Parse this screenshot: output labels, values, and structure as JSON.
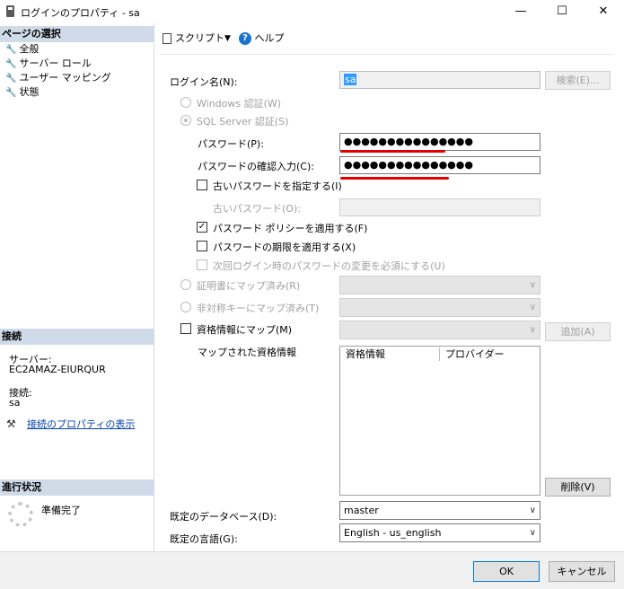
{
  "window": {
    "title": "ログインのプロパティ - sa",
    "minimize": "—",
    "maximize": "☐",
    "close": "✕"
  },
  "left_panel": {
    "page_select_header": "ページの選択",
    "pages": [
      {
        "label": "全般"
      },
      {
        "label": "サーバー ロール"
      },
      {
        "label": "ユーザー マッピング"
      },
      {
        "label": "状態"
      }
    ],
    "connection_header": "接続",
    "server_label": "サーバー:",
    "server_value": "EC2AMAZ-EIURQUR",
    "connection_label": "接続:",
    "connection_value": "sa",
    "connection_link": "接続のプロパティの表示",
    "progress_header": "進行状況",
    "progress_status": "準備完了"
  },
  "toolbar": {
    "script_label": "スクリプト",
    "script_dropdown": "▼",
    "help_label": "ヘルプ",
    "help_icon_text": "?"
  },
  "form": {
    "login_name_label": "ログイン名(N):",
    "login_name_value": "sa",
    "search_button": "検索(E)...",
    "windows_auth_label": "Windows 認証(W)",
    "sql_auth_label": "SQL Server 認証(S)",
    "password_label": "パスワード(P):",
    "password_value": "●●●●●●●●●●●●●●●",
    "confirm_password_label": "パスワードの確認入力(C):",
    "confirm_password_value": "●●●●●●●●●●●●●●●",
    "specify_old_password_label": "古いパスワードを指定する(I)",
    "old_password_label": "古いパスワード(O):",
    "enforce_policy_label": "パスワード ポリシーを適用する(F)",
    "enforce_policy_checked": "✓",
    "enforce_expiration_label": "パスワードの期限を適用する(X)",
    "must_change_label": "次回ログイン時のパスワードの変更を必須にする(U)",
    "cert_mapped_label": "証明書にマップ済み(R)",
    "asym_key_mapped_label": "非対称キーにマップ済み(T)",
    "credential_map_label": "資格情報にマップ(M)",
    "add_button": "追加(A)",
    "mapped_credentials_label": "マップされた資格情報",
    "grid_columns": [
      "資格情報",
      "プロバイダー"
    ],
    "remove_button": "削除(V)",
    "default_db_label": "既定のデータベース(D):",
    "default_db_value": "master",
    "default_lang_label": "既定の言語(G):",
    "default_lang_value": "English - us_english",
    "chevron": "∨"
  },
  "buttons": {
    "ok": "OK",
    "cancel": "キャンセル"
  },
  "colors": {
    "section_header_bg": "#cfdbe8",
    "highlight_underline": "#e00000",
    "link": "#0645ad",
    "selection_bg": "#3399ff"
  }
}
